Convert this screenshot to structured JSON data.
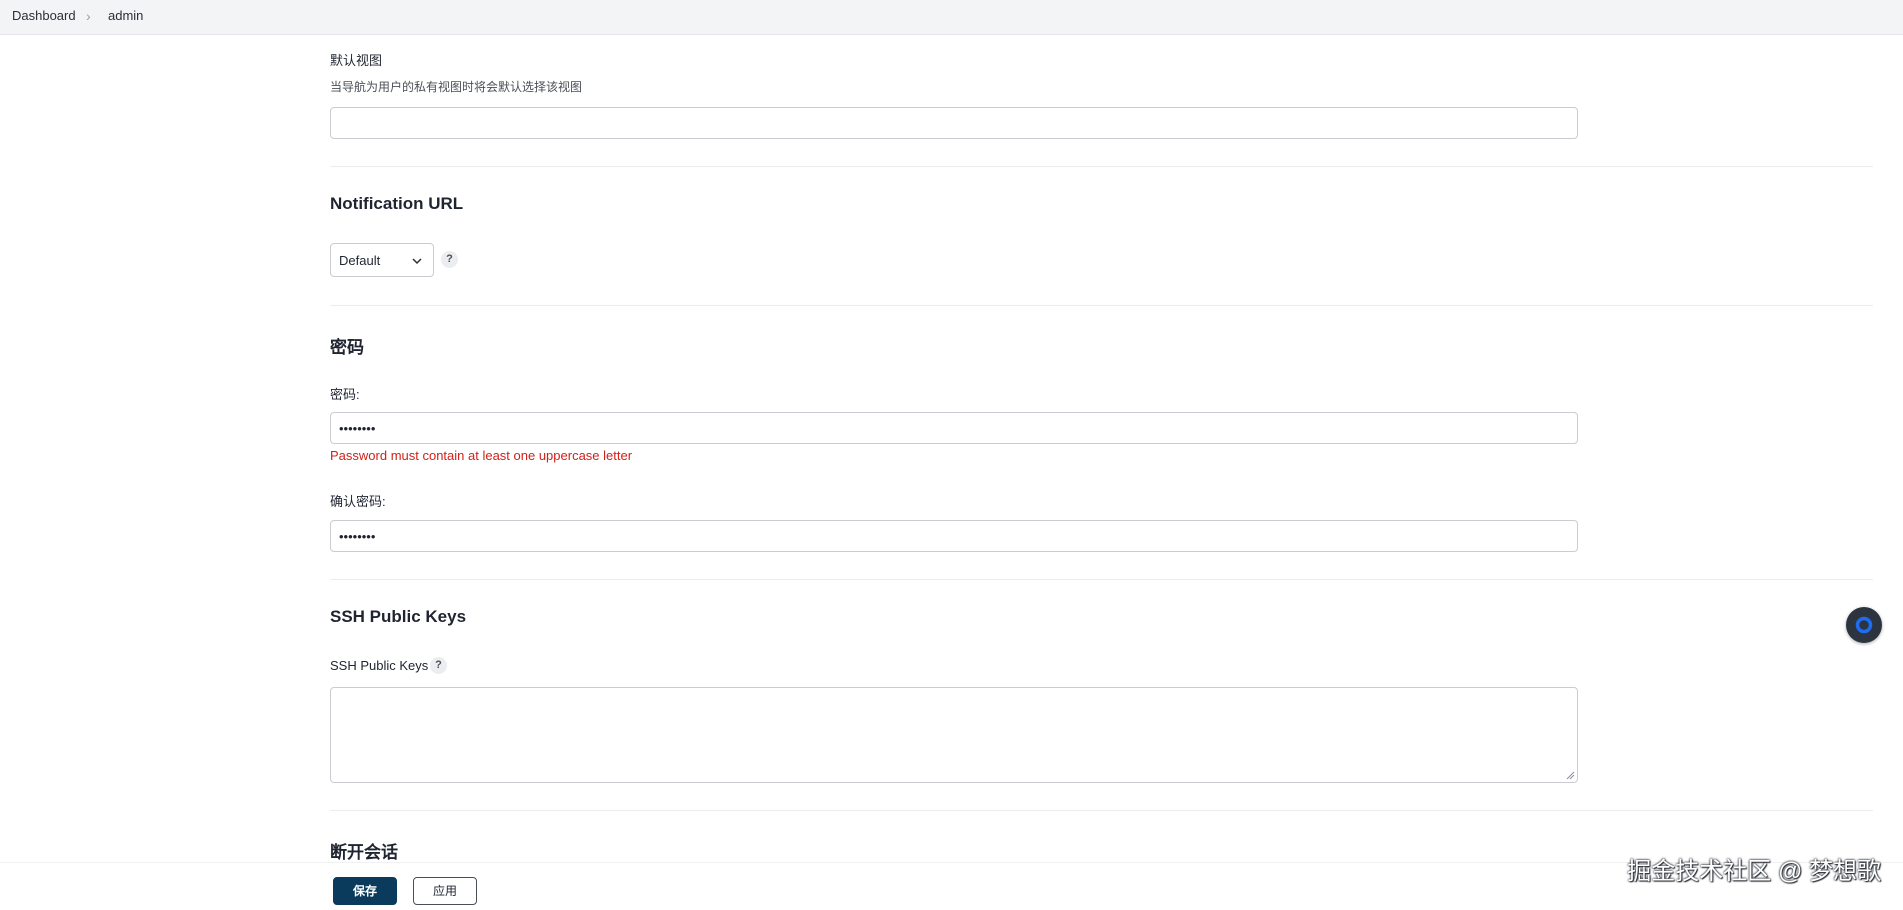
{
  "breadcrumb": {
    "items": [
      "Dashboard",
      "admin"
    ],
    "separator": "›"
  },
  "default_view": {
    "label": "默认视图",
    "description": "当导航为用户的私有视图时将会默认选择该视图",
    "value": ""
  },
  "notification": {
    "title": "Notification URL",
    "select_value": "Default",
    "help": "?"
  },
  "password_section": {
    "title": "密码",
    "password_label": "密码:",
    "password_value": "••••••••",
    "error": "Password must contain at least one uppercase letter",
    "confirm_label": "确认密码:",
    "confirm_value": "••••••••"
  },
  "ssh": {
    "title": "SSH Public Keys",
    "label": "SSH Public Keys",
    "help": "?",
    "value": ""
  },
  "session": {
    "title": "断开会话"
  },
  "actions": {
    "save_label": "保存",
    "apply_label": "应用"
  },
  "watermark": "掘金技术社区 @ 梦想歌",
  "colors": {
    "primary_button": "#0b3b5c",
    "error": "#d2201a",
    "topbar": "#f3f4f6",
    "float_ring": "#1e6cf0"
  }
}
